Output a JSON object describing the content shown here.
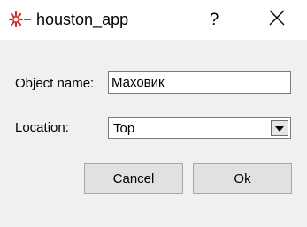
{
  "window": {
    "title": "houston_app",
    "help_glyph": "?",
    "icon": "houston-app-icon",
    "close_icon": "close-icon"
  },
  "form": {
    "name_label": "Object name:",
    "name_value": "Маховик",
    "location_label": "Location:",
    "location_value": "Top"
  },
  "buttons": {
    "cancel_label": "Cancel",
    "ok_label": "Ok"
  },
  "colors": {
    "titlebar_bg": "#ffffff",
    "window_bg": "#f0f0f0",
    "icon_accent": "#d32f2f"
  }
}
